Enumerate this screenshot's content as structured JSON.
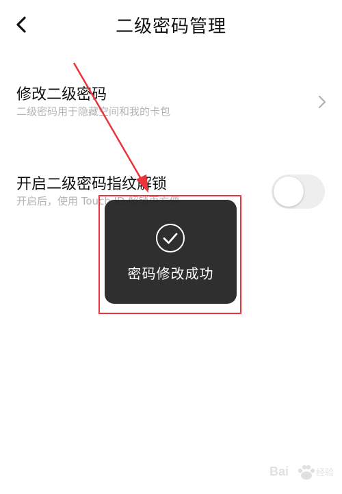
{
  "navbar": {
    "title": "二级密码管理",
    "back_icon": "chevron-left-icon"
  },
  "settings": {
    "modify": {
      "title": "修改二级密码",
      "subtitle": "二级密码用于隐藏空间和我的卡包",
      "icon": "chevron-right-icon"
    },
    "touch_unlock": {
      "title": "开启二级密码指纹解锁",
      "subtitle": "开启后，使用 Touch ID 解锁更方便",
      "enabled": false
    }
  },
  "toast": {
    "icon": "check-circle-icon",
    "message": "密码修改成功"
  },
  "annotation": {
    "color": "#e8343a"
  },
  "watermark": {
    "text": "Baidu经验"
  },
  "colors": {
    "primary_text": "#111111",
    "secondary_text": "#b4b4b4",
    "toast_bg": "#222222",
    "toggle_off": "#eeeeee"
  }
}
